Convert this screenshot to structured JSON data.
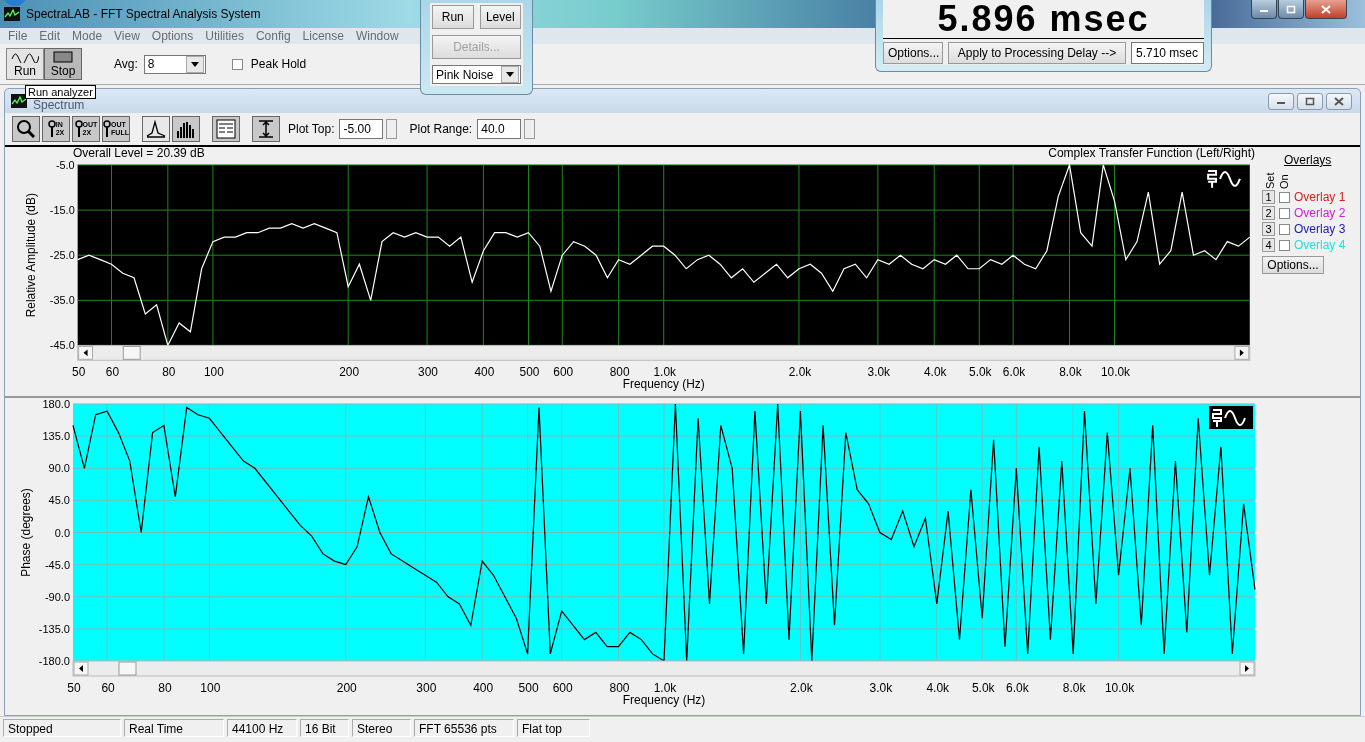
{
  "window": {
    "title": "SpectraLAB - FFT Spectral Analysis System"
  },
  "menu": [
    "File",
    "Edit",
    "Mode",
    "View",
    "Options",
    "Utilities",
    "Config",
    "License",
    "Window"
  ],
  "toolbar": {
    "buttons": [
      {
        "kind": "run",
        "label": "Run",
        "selected": false
      },
      {
        "kind": "stop",
        "label": "Stop",
        "selected": true
      }
    ],
    "avg_label": "Avg:",
    "avg_value": "8",
    "peak_hold": {
      "label": "Peak Hold",
      "checked": false
    }
  },
  "tooltip": "Run analyzer",
  "generator_panel": {
    "buttons": [
      "Run",
      "Level"
    ],
    "details": {
      "label": "Details...",
      "disabled": true
    },
    "signal": "Pink Noise"
  },
  "delay_panel": {
    "reading": "5.896 msec",
    "buttons": [
      "Options...",
      "Apply to Processing Delay -->"
    ],
    "value": "5.710 msec"
  },
  "spectrum_window": {
    "title": "Spectrum",
    "tools": [
      {
        "kind": "zoom"
      },
      {
        "kind": "zoom-in",
        "line1": "IN",
        "line2": "2X"
      },
      {
        "kind": "zoom-out",
        "line1": "OUT",
        "line2": "2X"
      },
      {
        "kind": "zoom-full",
        "line1": "OUT",
        "line2": "FULL"
      }
    ],
    "view_modes": [
      {
        "kind": "line",
        "selected": true
      },
      {
        "kind": "bars",
        "selected": false
      }
    ],
    "plot_top": {
      "label": "Plot Top:",
      "value": "-5.00"
    },
    "plot_range": {
      "label": "Plot Range:",
      "value": "40.0"
    },
    "overall_level": "Overall Level = 20.39 dB",
    "overlays": {
      "title": "Overlays",
      "set_header": "Set",
      "on_header": "On",
      "options": "Options...",
      "items": [
        {
          "set": "1",
          "label": "Overlay 1",
          "color": "#d42020",
          "checked": false
        },
        {
          "set": "2",
          "label": "Overlay 2",
          "color": "#d020d0",
          "checked": false
        },
        {
          "set": "3",
          "label": "Overlay 3",
          "color": "#2020b0",
          "checked": false
        },
        {
          "set": "4",
          "label": "Overlay 4",
          "color": "#20e0e0",
          "checked": false
        }
      ]
    },
    "amplitude_chart": {
      "chart_data": {
        "type": "line",
        "title": "Complex Transfer Function (Left/Right)",
        "xlabel": "Frequency (Hz)",
        "ylabel": "Relative Amplitude (dB)",
        "grid": true,
        "ylim": [
          -45,
          -5
        ],
        "categories": [
          "50",
          null,
          null,
          "60",
          null,
          null,
          null,
          null,
          "80",
          null,
          null,
          null,
          "100",
          null,
          null,
          null,
          null,
          null,
          null,
          null,
          null,
          null,
          null,
          null,
          "200",
          null,
          null,
          null,
          null,
          null,
          null,
          "300",
          null,
          null,
          null,
          null,
          "400",
          null,
          null,
          null,
          "500",
          null,
          null,
          "600",
          null,
          null,
          null,
          null,
          "800",
          null,
          null,
          null,
          "1.0k",
          null,
          null,
          null,
          null,
          null,
          null,
          null,
          null,
          null,
          null,
          null,
          "2.0k",
          null,
          null,
          null,
          null,
          null,
          null,
          "3.0k",
          null,
          null,
          null,
          null,
          "4.0k",
          null,
          null,
          null,
          "5.0k",
          null,
          null,
          "6.0k",
          null,
          null,
          null,
          null,
          "8.0k",
          null,
          null,
          null,
          "10.0k",
          null,
          null,
          null,
          null,
          null,
          null,
          null,
          null,
          null,
          null,
          null,
          null
        ],
        "yticks": [
          {
            "value": -5,
            "label": "-5.0"
          },
          {
            "value": -15,
            "label": "-15.0"
          },
          {
            "value": -25,
            "label": "-25.0"
          },
          {
            "value": -35,
            "label": "-35.0"
          },
          {
            "value": -45,
            "label": "-45.0"
          }
        ],
        "series": [
          {
            "color": "#ffffff",
            "values": [
              -26,
              -25,
              -26,
              -27,
              -29,
              -30,
              -38,
              -36,
              -45,
              -40,
              -42,
              -28,
              -22,
              -21,
              -21,
              -20,
              -20,
              -19,
              -19,
              -18,
              -19,
              -18,
              -19,
              -20,
              -32,
              -27,
              -35,
              -22,
              -20,
              -21,
              -20,
              -21,
              -21,
              -23,
              -21,
              -31,
              -24,
              -20,
              -20,
              -21,
              -20,
              -23,
              -33,
              -25,
              -22,
              -23,
              -25,
              -30,
              -26,
              -27,
              -25,
              -23,
              -23,
              -25,
              -28,
              -26,
              -25,
              -27,
              -30,
              -28,
              -31,
              -29,
              -27,
              -30,
              -28,
              -27,
              -29,
              -33,
              -28,
              -27,
              -30,
              -26,
              -27,
              -25,
              -27,
              -28,
              -26,
              -27,
              -25,
              -28,
              -28,
              -26,
              -27,
              -25,
              -27,
              -28,
              -24,
              -12,
              -5,
              -20,
              -23,
              -5,
              -13,
              -26,
              -22,
              -11,
              -27,
              -24,
              -11,
              -25,
              -24,
              -26,
              -22,
              -23,
              -21
            ]
          }
        ]
      }
    },
    "phase_chart": {
      "chart_data": {
        "type": "line",
        "xlabel": "Frequency (Hz)",
        "ylabel": "Phase (degrees)",
        "grid": true,
        "ylim": [
          -180,
          180
        ],
        "categories": [
          "50",
          null,
          null,
          "60",
          null,
          null,
          null,
          null,
          "80",
          null,
          null,
          null,
          "100",
          null,
          null,
          null,
          null,
          null,
          null,
          null,
          null,
          null,
          null,
          null,
          "200",
          null,
          null,
          null,
          null,
          null,
          null,
          "300",
          null,
          null,
          null,
          null,
          "400",
          null,
          null,
          null,
          "500",
          null,
          null,
          "600",
          null,
          null,
          null,
          null,
          "800",
          null,
          null,
          null,
          "1.0k",
          null,
          null,
          null,
          null,
          null,
          null,
          null,
          null,
          null,
          null,
          null,
          "2.0k",
          null,
          null,
          null,
          null,
          null,
          null,
          "3.0k",
          null,
          null,
          null,
          null,
          "4.0k",
          null,
          null,
          null,
          "5.0k",
          null,
          null,
          "6.0k",
          null,
          null,
          null,
          null,
          "8.0k",
          null,
          null,
          null,
          "10.0k",
          null,
          null,
          null,
          null,
          null,
          null,
          null,
          null,
          null,
          null,
          null,
          null
        ],
        "yticks": [
          {
            "value": 180,
            "label": "180.0"
          },
          {
            "value": 135,
            "label": "135.0"
          },
          {
            "value": 90,
            "label": "90.0"
          },
          {
            "value": 45,
            "label": "45.0"
          },
          {
            "value": 0,
            "label": "0.0"
          },
          {
            "value": -45,
            "label": "-45.0"
          },
          {
            "value": -90,
            "label": "-90.0"
          },
          {
            "value": -135,
            "label": "-135.0"
          },
          {
            "value": -180,
            "label": "-180.0"
          }
        ],
        "series": [
          {
            "color": "#000000",
            "values": [
              150,
              90,
              165,
              170,
              140,
              100,
              0,
              140,
              150,
              50,
              175,
              165,
              160,
              140,
              120,
              100,
              90,
              70,
              50,
              30,
              10,
              -5,
              -30,
              -40,
              -45,
              -20,
              50,
              0,
              -30,
              -40,
              -50,
              -60,
              -70,
              -90,
              -100,
              -130,
              -40,
              -60,
              -90,
              -120,
              -170,
              175,
              -170,
              -110,
              -130,
              -150,
              -140,
              -160,
              -160,
              -140,
              -150,
              -170,
              -180,
              180,
              -180,
              160,
              -100,
              150,
              90,
              -170,
              170,
              -100,
              180,
              -150,
              170,
              -180,
              150,
              -130,
              140,
              60,
              40,
              0,
              -10,
              30,
              -20,
              20,
              -100,
              30,
              -150,
              60,
              -120,
              130,
              -160,
              90,
              -170,
              120,
              -150,
              100,
              -170,
              170,
              -100,
              140,
              -60,
              90,
              -130,
              150,
              -170,
              100,
              -140,
              160,
              -60,
              120,
              -170,
              40,
              -80
            ]
          }
        ]
      }
    }
  },
  "status_bar": [
    "Stopped",
    "Real Time",
    "44100 Hz",
    "16 Bit",
    "Stereo",
    "FFT 65536 pts",
    "Flat top"
  ]
}
